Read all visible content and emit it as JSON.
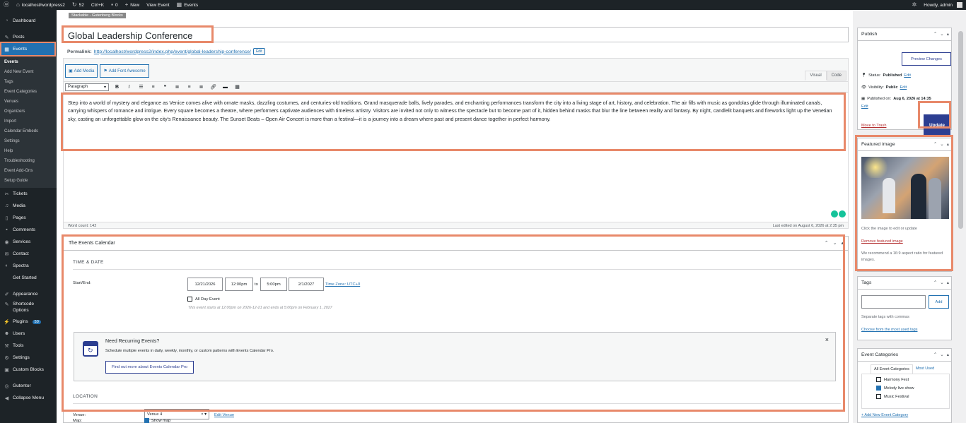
{
  "admin_bar": {
    "site": "localhost/wordpress2",
    "updates_count": "52",
    "shortcut": "Ctrl+K",
    "comments_count": "0",
    "new_label": "New",
    "view_event": "View Event",
    "events": "Events",
    "howdy": "Howdy, admin"
  },
  "sidebar": {
    "dashboard": "Dashboard",
    "posts": "Posts",
    "events": "Events",
    "submenu": [
      "Events",
      "Add New Event",
      "Tags",
      "Event Categories",
      "Venues",
      "Organizers",
      "Import",
      "Calendar Embeds",
      "Settings",
      "Help",
      "Troubleshooting",
      "Event Add-Ons",
      "Setup Guide"
    ],
    "tickets": "Tickets",
    "media": "Media",
    "pages": "Pages",
    "comments": "Comments",
    "services": "Services",
    "contact": "Contact",
    "spectra": "Spectra",
    "get_started": "Get Started",
    "appearance": "Appearance",
    "shortcode_options_1": "Shortcode",
    "shortcode_options_2": "Options",
    "plugins": "Plugins",
    "plugins_badge": "50",
    "users": "Users",
    "tools": "Tools",
    "settings": "Settings",
    "custom_blocks": "Custom Blocks",
    "gutentor": "Gutentor",
    "collapse": "Collapse Menu"
  },
  "editor": {
    "notice": "Stackable - Gutenberg Blocks",
    "title": "Global Leadership Conference",
    "permalink_label": "Permalink:",
    "permalink_url": "http://localhost/wordpress2/index.php/event/global-leadership-conference/",
    "permalink_edit": "Edit",
    "add_media": "Add Media",
    "add_font_awesome": "Add Font Awesome",
    "tab_visual": "Visual",
    "tab_code": "Code",
    "format_select": "Paragraph",
    "content": "Step into a world of mystery and elegance as Venice comes alive with ornate masks, dazzling costumes, and centuries-old traditions. Grand masquerade balls, lively parades, and enchanting performances transform the city into a living stage of art, history, and celebration. The air fills with music as gondolas glide through illuminated canals, carrying whispers of romance and intrigue. Every square becomes a theatre, where performers captivate audiences with timeless artistry. Visitors are invited not only to witness the spectacle but to become part of it, hidden behind masks that blur the line between reality and fantasy. By night, candlelit banquets and fireworks light up the Venetian sky, casting an unforgettable glow on the city's Renaissance beauty. The Sunset Beats – Open Air Concert is more than a festival—it is a journey into a dream where past and present dance together in perfect harmony.",
    "word_count": "Word count: 142",
    "last_edited": "Last edited on August 6, 2026 at 2:35 pm"
  },
  "tec": {
    "header": "The Events Calendar",
    "time_date": "TIME & DATE",
    "start_end": "Start/End:",
    "start_date": "12/21/2026",
    "start_time": "12:00pm",
    "to": "to",
    "end_time": "5:00pm",
    "end_date": "2/1/2027",
    "timezone": "Time Zone: UTC+0",
    "all_day": "All Day Event",
    "summary": "This event starts at 12:00pm on 2026-12-21 and ends at 5:00pm on February 1, 2027",
    "recurring_title": "Need Recurring Events?",
    "recurring_desc": "Schedule multiple events in daily, weekly, monthly, or custom patterns with Events Calendar Pro.",
    "recurring_btn": "Find out more about Events Calendar Pro",
    "close": "×",
    "location": "LOCATION",
    "venue_label": "Venue:",
    "venue_value": "Venue 4",
    "edit_venue": "Edit Venue",
    "map_label": "Map:",
    "show_map": "Show map"
  },
  "publish": {
    "title": "Publish",
    "preview": "Preview Changes",
    "status": "Status:",
    "status_value": "Published",
    "visibility": "Visibility:",
    "visibility_value": "Public",
    "published_on": "Published on:",
    "published_value": "Aug 6, 2026 at 14:35",
    "edit": "Edit",
    "trash": "Move to Trash",
    "update": "Update"
  },
  "featured": {
    "title": "Featured image",
    "click_hint": "Click the image to edit or update",
    "remove": "Remove featured image",
    "recommend": "We recommend a 16:9 aspect ratio for featured images."
  },
  "tags": {
    "title": "Tags",
    "add": "Add",
    "hint": "Separate tags with commas",
    "choose": "Choose from the most used tags"
  },
  "categories": {
    "title": "Event Categories",
    "tab_all": "All Event Categories",
    "tab_most": "Most Used",
    "items": [
      {
        "label": "Harmony Fest",
        "checked": false
      },
      {
        "label": "Melody live show",
        "checked": true
      },
      {
        "label": "Music Festival",
        "checked": false
      }
    ],
    "add_new": "+ Add New Event Category"
  },
  "colors": {
    "highlight": "#e8896a",
    "admin_bg": "#1d2327",
    "accent": "#2271b1",
    "update_btn": "#2c3e91"
  }
}
